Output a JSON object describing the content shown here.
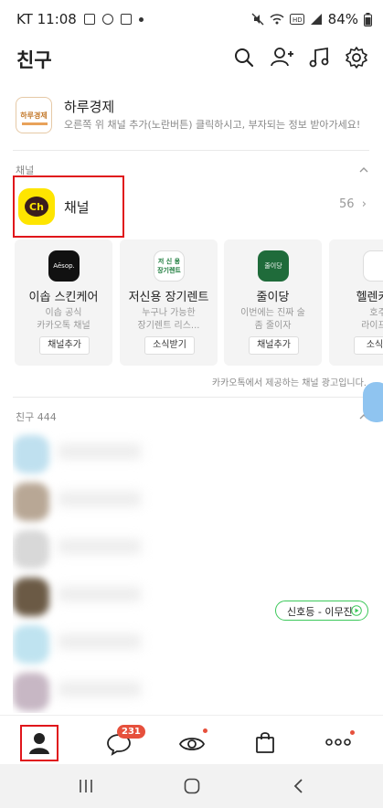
{
  "status_bar": {
    "time": "KT 11:08",
    "battery": "84%"
  },
  "header": {
    "title": "친구"
  },
  "banner": {
    "logo_text": "하루경제",
    "title": "하루경제",
    "description": "오른쪽 위 채널 추가(노란버튼) 클릭하시고, 부자되는 정보 받아가세요!"
  },
  "channel_section": {
    "label": "채널",
    "channel_label": "채널",
    "channel_icon_text": "Ch",
    "count": "56"
  },
  "cards": [
    {
      "logo_text": "Aēsop.",
      "name": "이솝 스킨케어",
      "desc": "이솝 공식\n카카오톡 채널",
      "button": "채널추가"
    },
    {
      "logo_text": "저 신 용\n장기렌트",
      "name": "저신용 장기렌트",
      "desc": "누구나 가능한\n장기렌트 리스...",
      "button": "소식받기"
    },
    {
      "logo_text": "줄이당",
      "name": "줄이당",
      "desc": "이번에는 진짜 술\n좀 줄이자",
      "button": "채널추가"
    },
    {
      "logo_text": "",
      "name": "헬렌카민",
      "desc": "호주\n라이프스",
      "button": "소식받"
    }
  ],
  "ad_note": "카카오톡에서 제공하는 채널 광고입니다.",
  "friends_section": {
    "label": "친구 444"
  },
  "music_chip": {
    "label": "신호등 - 이무진"
  },
  "tabbar": {
    "chat_badge": "231"
  },
  "colors": {
    "accent_yellow": "#fee500",
    "badge_red": "#e6503c",
    "highlight_red": "#e0161b",
    "music_green": "#3cc85a"
  }
}
